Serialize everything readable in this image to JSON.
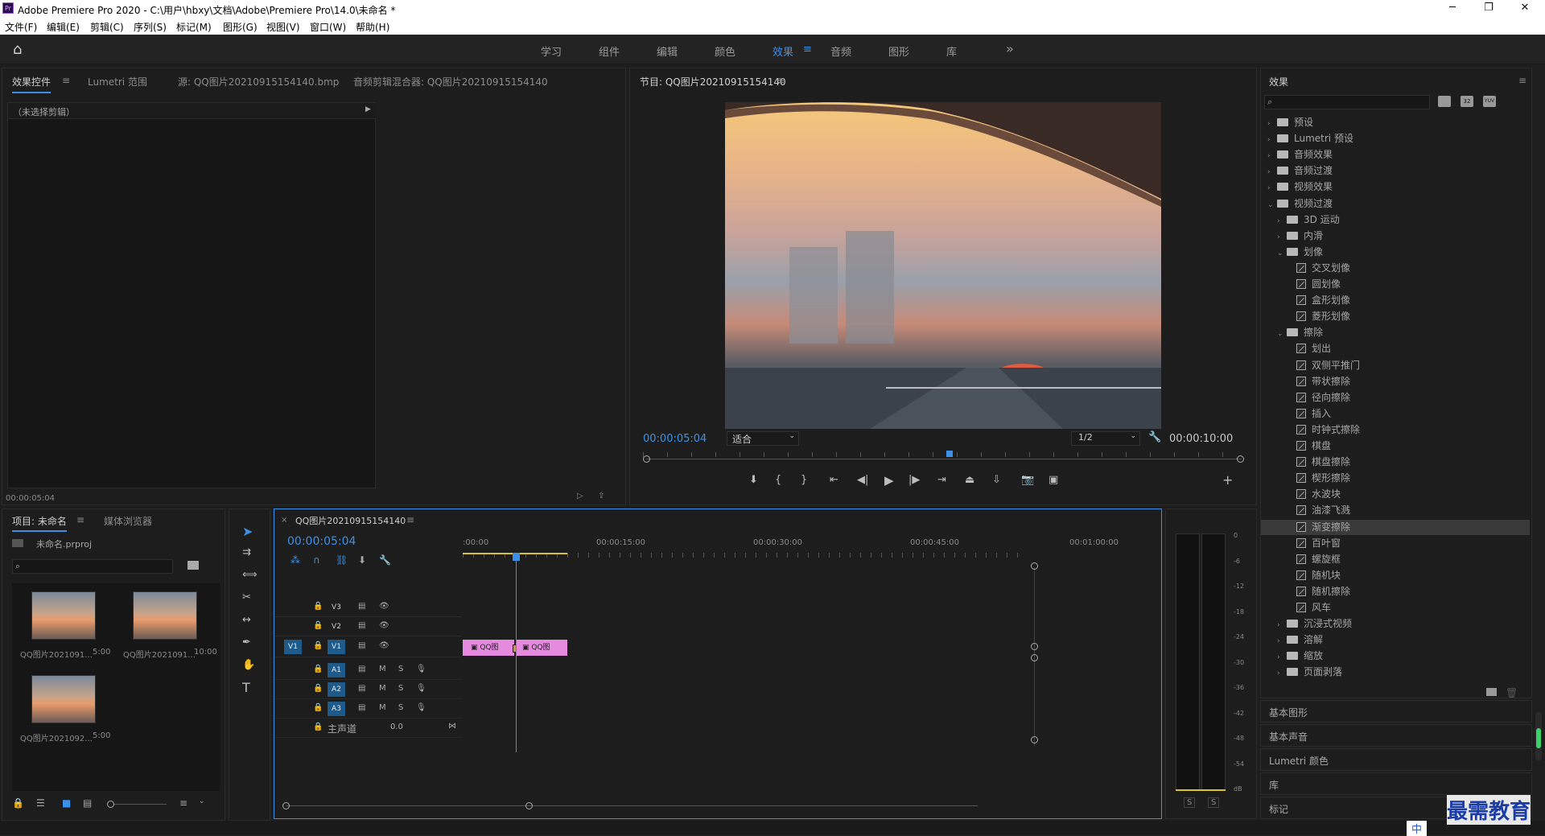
{
  "window": {
    "title": "Adobe Premiere Pro 2020 - C:\\用户\\hbxy\\文档\\Adobe\\Premiere Pro\\14.0\\未命名 *",
    "app_icon": "Pr"
  },
  "menu": [
    "文件(F)",
    "编辑(E)",
    "剪辑(C)",
    "序列(S)",
    "标记(M)",
    "图形(G)",
    "视图(V)",
    "窗口(W)",
    "帮助(H)"
  ],
  "workspaces": {
    "items": [
      "学习",
      "组件",
      "编辑",
      "颜色",
      "效果",
      "音频",
      "图形",
      "库"
    ],
    "active": "效果",
    "more": "»"
  },
  "source_panel": {
    "tabs": [
      "效果控件",
      "Lumetri 范围",
      "源: QQ图片20210915154140.bmp",
      "音频剪辑混合器: QQ图片20210915154140"
    ],
    "no_clip": "（未选择剪辑）",
    "timecode": "00:00:05:04"
  },
  "program": {
    "title": "节目: QQ图片20210915154140",
    "timecode": "00:00:05:04",
    "fit": "适合",
    "quality": "1/2",
    "duration": "00:00:10:00",
    "playhead_fraction": 0.51
  },
  "effects": {
    "title": "效果",
    "tree": [
      {
        "label": "预设",
        "level": 0,
        "type": "folder",
        "expanded": false
      },
      {
        "label": "Lumetri 预设",
        "level": 0,
        "type": "folder",
        "expanded": false
      },
      {
        "label": "音频效果",
        "level": 0,
        "type": "folder",
        "expanded": false
      },
      {
        "label": "音频过渡",
        "level": 0,
        "type": "folder",
        "expanded": false
      },
      {
        "label": "视频效果",
        "level": 0,
        "type": "folder",
        "expanded": false
      },
      {
        "label": "视频过渡",
        "level": 0,
        "type": "folder",
        "expanded": true
      },
      {
        "label": "3D 运动",
        "level": 1,
        "type": "folder",
        "expanded": false
      },
      {
        "label": "内滑",
        "level": 1,
        "type": "folder",
        "expanded": false
      },
      {
        "label": "划像",
        "level": 1,
        "type": "folder",
        "expanded": true
      },
      {
        "label": "交叉划像",
        "level": 2,
        "type": "fx"
      },
      {
        "label": "圆划像",
        "level": 2,
        "type": "fx"
      },
      {
        "label": "盒形划像",
        "level": 2,
        "type": "fx"
      },
      {
        "label": "菱形划像",
        "level": 2,
        "type": "fx"
      },
      {
        "label": "擦除",
        "level": 1,
        "type": "folder",
        "expanded": true
      },
      {
        "label": "划出",
        "level": 2,
        "type": "fx"
      },
      {
        "label": "双侧平推门",
        "level": 2,
        "type": "fx"
      },
      {
        "label": "带状擦除",
        "level": 2,
        "type": "fx"
      },
      {
        "label": "径向擦除",
        "level": 2,
        "type": "fx"
      },
      {
        "label": "插入",
        "level": 2,
        "type": "fx"
      },
      {
        "label": "时钟式擦除",
        "level": 2,
        "type": "fx"
      },
      {
        "label": "棋盘",
        "level": 2,
        "type": "fx"
      },
      {
        "label": "棋盘擦除",
        "level": 2,
        "type": "fx"
      },
      {
        "label": "楔形擦除",
        "level": 2,
        "type": "fx"
      },
      {
        "label": "水波块",
        "level": 2,
        "type": "fx"
      },
      {
        "label": "油漆飞溅",
        "level": 2,
        "type": "fx"
      },
      {
        "label": "渐变擦除",
        "level": 2,
        "type": "fx",
        "selected": true
      },
      {
        "label": "百叶窗",
        "level": 2,
        "type": "fx"
      },
      {
        "label": "螺旋框",
        "level": 2,
        "type": "fx"
      },
      {
        "label": "随机块",
        "level": 2,
        "type": "fx"
      },
      {
        "label": "随机擦除",
        "level": 2,
        "type": "fx"
      },
      {
        "label": "风车",
        "level": 2,
        "type": "fx"
      },
      {
        "label": "沉浸式视频",
        "level": 1,
        "type": "folder",
        "expanded": false
      },
      {
        "label": "溶解",
        "level": 1,
        "type": "folder",
        "expanded": false
      },
      {
        "label": "缩放",
        "level": 1,
        "type": "folder",
        "expanded": false
      },
      {
        "label": "页面剥落",
        "level": 1,
        "type": "folder",
        "expanded": false
      }
    ],
    "sections": [
      "基本图形",
      "基本声音",
      "Lumetri 颜色",
      "库",
      "标记"
    ]
  },
  "project": {
    "tabs": [
      "项目: 未命名",
      "媒体浏览器"
    ],
    "file": "未命名.prproj",
    "items": [
      {
        "name": "QQ图片2021091...",
        "dur": "5:00"
      },
      {
        "name": "QQ图片2021091...",
        "dur": "10:00"
      },
      {
        "name": "QQ图片2021092...",
        "dur": "5:00"
      }
    ]
  },
  "timeline": {
    "tab": "QQ图片20210915154140",
    "timecode": "00:00:05:04",
    "ruler": [
      ":00:00",
      "00:00:15:00",
      "00:00:30:00",
      "00:00:45:00",
      "00:01:00:00"
    ],
    "video_tracks": [
      "V3",
      "V2",
      "V1"
    ],
    "audio_tracks": [
      "A1",
      "A2",
      "A3"
    ],
    "master": "主声道",
    "master_val": "0.0",
    "source_v": "V1",
    "clips": [
      "QQ图",
      "QQ图"
    ]
  },
  "meter": {
    "labels": [
      "0",
      "-6",
      "-12",
      "-18",
      "-24",
      "-30",
      "-36",
      "-42",
      "-48",
      "-54",
      "dB"
    ],
    "solo": [
      "S",
      "S"
    ]
  },
  "watermark": "最需教育",
  "ime": "中"
}
